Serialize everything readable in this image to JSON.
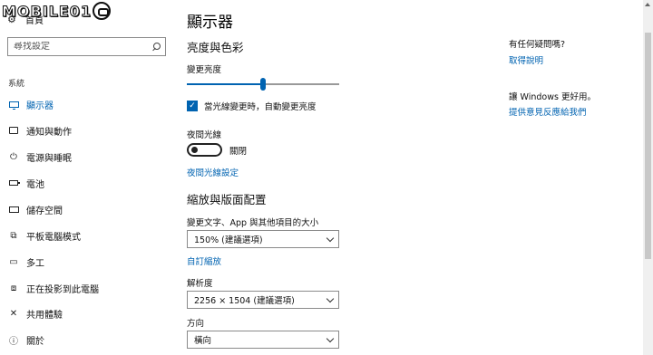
{
  "watermark": {
    "text": "MOBILE01"
  },
  "nav": {
    "home_label": "首頁",
    "search_placeholder": "尋找設定",
    "section_label": "系統",
    "items": [
      {
        "label": "顯示器",
        "icon": "monitor-icon",
        "active": true
      },
      {
        "label": "通知與動作",
        "icon": "notification-icon"
      },
      {
        "label": "電源與睡眠",
        "icon": "power-icon"
      },
      {
        "label": "電池",
        "icon": "battery-icon"
      },
      {
        "label": "儲存空間",
        "icon": "storage-icon"
      },
      {
        "label": "平板電腦模式",
        "icon": "tablet-mode-icon"
      },
      {
        "label": "多工",
        "icon": "multitasking-icon"
      },
      {
        "label": "正在投影到此電腦",
        "icon": "projecting-icon"
      },
      {
        "label": "共用體驗",
        "icon": "shared-experiences-icon"
      },
      {
        "label": "關於",
        "icon": "info-icon"
      }
    ]
  },
  "main": {
    "title": "顯示器",
    "brightness_heading": "亮度與色彩",
    "brightness_label": "變更亮度",
    "brightness_value": 0.5,
    "auto_brightness_label": "當光線變更時，自動變更亮度",
    "auto_brightness_checked": true,
    "night_light_label": "夜間光線",
    "night_light_state": "關閉",
    "night_light_settings_link": "夜間光線設定",
    "scale_heading": "縮放與版面配置",
    "scale_label": "變更文字、App 與其他項目的大小",
    "scale_value": "150% (建議選項)",
    "custom_scaling_link": "自訂縮放",
    "resolution_label": "解析度",
    "resolution_value": "2256 × 1504 (建議選項)",
    "orientation_label": "方向",
    "orientation_value": "橫向"
  },
  "right": {
    "question": "有任何疑問嗎?",
    "help_link": "取得說明",
    "improve_text": "讓 Windows 更好用。",
    "feedback_link": "提供意見反應給我們"
  },
  "colors": {
    "accent": "#0063b1"
  }
}
